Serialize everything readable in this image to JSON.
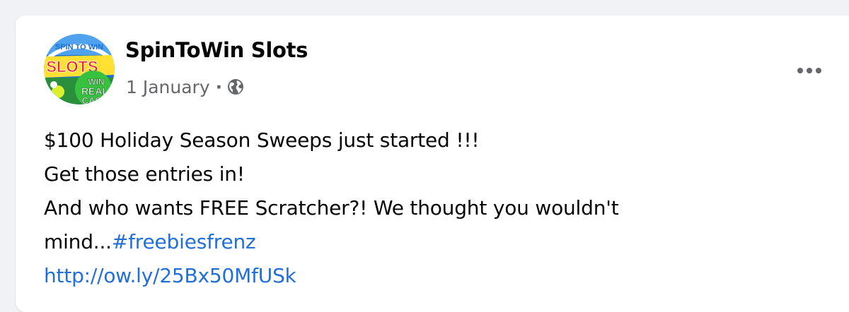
{
  "post": {
    "author": "SpinToWin Slots",
    "date": "1 January",
    "separator": "·",
    "privacy_icon": "globe-icon",
    "more_icon": "more-horizontal-icon",
    "avatar": {
      "icon": "spintowin-logo",
      "logo_text_arc": "SPIN TO WIN",
      "logo_text_main": "SLOTS",
      "badge_line1": "WIN",
      "badge_line2": "REAL",
      "badge_line3": "CASH"
    },
    "lines": [
      "$100 Holiday Season Sweeps just started !!!",
      "Get those entries in!",
      "And who wants FREE Scratcher?! We thought you wouldn't"
    ],
    "line4_text": "mind...",
    "hashtag": "#freebiesfrenz",
    "link": "http://ow.ly/25Bx50MfUSk"
  },
  "colors": {
    "background": "#f0f2f5",
    "card": "#ffffff",
    "text": "#050505",
    "secondary_text": "#65676b",
    "link": "#216fdb"
  }
}
